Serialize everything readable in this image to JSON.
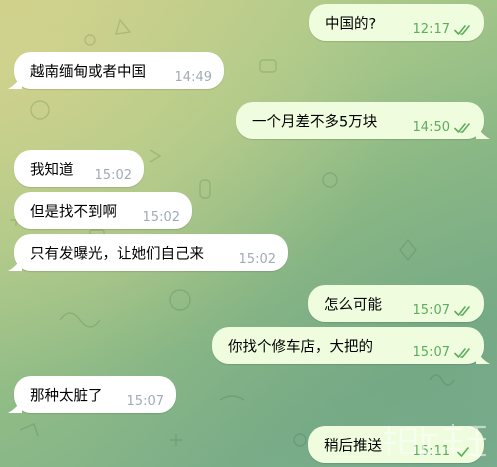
{
  "messages": [
    {
      "direction": "out",
      "text": "中国的?",
      "time": "12:17",
      "status": "read"
    },
    {
      "direction": "in",
      "text": "越南缅甸或者中国",
      "time": "14:49"
    },
    {
      "direction": "out",
      "text": "一个月差不多5万块",
      "time": "14:50",
      "status": "read"
    },
    {
      "direction": "in",
      "text": "我知道",
      "time": "15:02"
    },
    {
      "direction": "in",
      "text": "但是找不到啊",
      "time": "15:02"
    },
    {
      "direction": "in",
      "text": "只有发曝光，让她们自己来",
      "time": "15:02"
    },
    {
      "direction": "out",
      "text": "怎么可能",
      "time": "15:07",
      "status": "read"
    },
    {
      "direction": "out",
      "text": "你找个修车店，大把的",
      "time": "15:07",
      "status": "read"
    },
    {
      "direction": "in",
      "text": "那种太脏了",
      "time": "15:07"
    },
    {
      "direction": "out",
      "text": "稍后推送",
      "time": "15:11",
      "status": "sent"
    }
  ],
  "colors": {
    "incoming_bubble": "#ffffff",
    "outgoing_bubble": "#effdde",
    "outgoing_meta": "#5cad5e",
    "incoming_meta": "#a0acb6"
  }
}
